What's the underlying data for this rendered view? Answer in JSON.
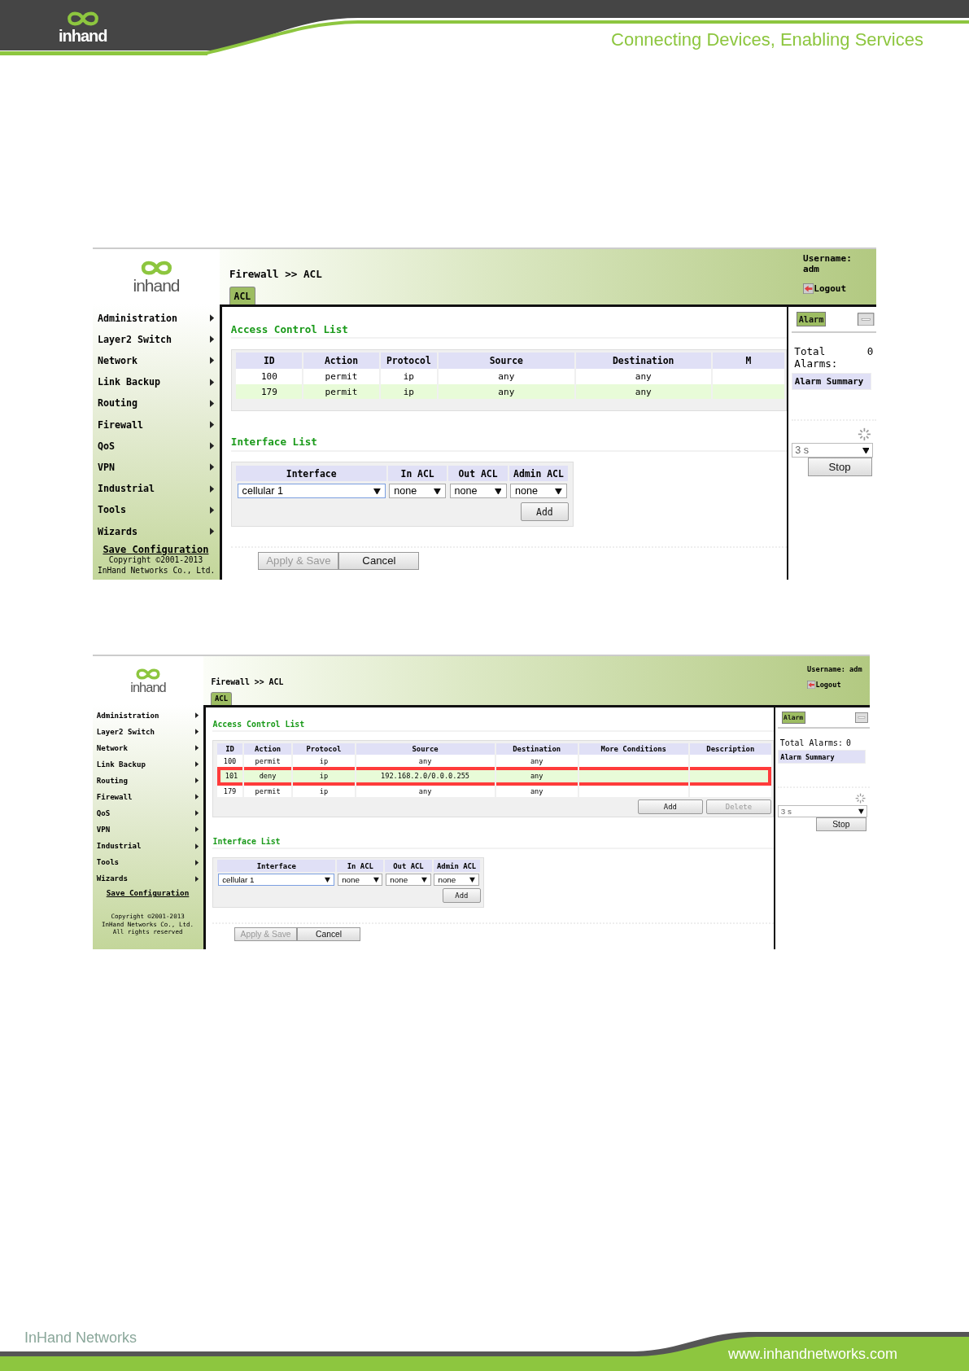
{
  "page_header": {
    "logo_text": "inhand",
    "tagline": "Connecting Devices, Enabling Services"
  },
  "screenshots": [
    {
      "logo_text": "inhand",
      "breadcrumb": "Firewall >> ACL",
      "tabs": [
        {
          "label": "ACL",
          "selected": true
        }
      ],
      "username_lines": [
        "Username:",
        "adm"
      ],
      "logout": "Logout",
      "menu": [
        {
          "label": "Administration"
        },
        {
          "label": "Layer2 Switch"
        },
        {
          "label": "Network"
        },
        {
          "label": "Link Backup"
        },
        {
          "label": "Routing"
        },
        {
          "label": "Firewall"
        },
        {
          "label": "QoS"
        },
        {
          "label": "VPN"
        },
        {
          "label": "Industrial"
        },
        {
          "label": "Tools"
        },
        {
          "label": "Wizards"
        }
      ],
      "save_link": "Save Configuration",
      "copyright_lines": [
        "Copyright ©2001-2013",
        "InHand Networks Co., Ltd."
      ],
      "acl": {
        "title": "Access Control List",
        "columns": [
          "ID",
          "Action",
          "Protocol",
          "Source",
          "Destination",
          "M"
        ],
        "rows": [
          {
            "cells": [
              "100",
              "permit",
              "ip",
              "any",
              "any"
            ],
            "highlighted": false,
            "marked": false
          },
          {
            "cells": [
              "179",
              "permit",
              "ip",
              "any",
              "any"
            ],
            "highlighted": true,
            "marked": false
          }
        ]
      },
      "interfaces": {
        "title": "Interface List",
        "columns": [
          "Interface",
          "In ACL",
          "Out ACL",
          "Admin ACL"
        ],
        "values": [
          "cellular 1",
          "none",
          "none",
          "none"
        ],
        "add_button": "Add"
      },
      "actions": [
        {
          "label": "Apply & Save",
          "disabled": true
        },
        {
          "label": "Cancel",
          "disabled": false
        }
      ],
      "alarm": {
        "tab": "Alarm",
        "total_label": "Total Alarms:",
        "total_value": "0",
        "summary": "Alarm Summary",
        "refresh": "3 s",
        "stop": "Stop"
      }
    },
    {
      "logo_text": "inhand",
      "breadcrumb": "Firewall >> ACL",
      "tabs": [
        {
          "label": "ACL",
          "selected": true
        }
      ],
      "username_lines": [
        "Username: adm"
      ],
      "logout": "Logout",
      "menu": [
        {
          "label": "Administration"
        },
        {
          "label": "Layer2 Switch"
        },
        {
          "label": "Network"
        },
        {
          "label": "Link Backup"
        },
        {
          "label": "Routing"
        },
        {
          "label": "Firewall"
        },
        {
          "label": "QoS"
        },
        {
          "label": "VPN"
        },
        {
          "label": "Industrial"
        },
        {
          "label": "Tools"
        },
        {
          "label": "Wizards"
        }
      ],
      "save_link": "Save Configuration",
      "copyright_lines": [
        "Copyright ©2001-2013",
        "InHand Networks Co., Ltd.",
        "All rights reserved"
      ],
      "acl": {
        "title": "Access Control List",
        "columns": [
          "ID",
          "Action",
          "Protocol",
          "Source",
          "Destination",
          "More Conditions",
          "Description"
        ],
        "rows": [
          {
            "cells": [
              "100",
              "permit",
              "ip",
              "any",
              "any"
            ],
            "highlighted": false,
            "marked": false
          },
          {
            "cells": [
              "101",
              "deny",
              "ip",
              "192.168.2.0/0.0.0.255",
              "any"
            ],
            "highlighted": true,
            "marked": true
          },
          {
            "cells": [
              "179",
              "permit",
              "ip",
              "any",
              "any"
            ],
            "highlighted": false,
            "marked": false
          }
        ],
        "buttons": [
          {
            "label": "Add",
            "disabled": false
          },
          {
            "label": "Delete",
            "disabled": true
          }
        ]
      },
      "interfaces": {
        "title": "Interface List",
        "columns": [
          "Interface",
          "In ACL",
          "Out ACL",
          "Admin ACL"
        ],
        "values": [
          "cellular 1",
          "none",
          "none",
          "none"
        ],
        "add_button": "Add"
      },
      "actions": [
        {
          "label": "Apply & Save",
          "disabled": true
        },
        {
          "label": "Cancel",
          "disabled": false
        }
      ],
      "alarm": {
        "tab": "Alarm",
        "total_label": "Total Alarms:",
        "total_value": "0",
        "summary": "Alarm Summary",
        "refresh": "3 s",
        "stop": "Stop"
      }
    }
  ],
  "page_footer": {
    "company": "InHand Networks",
    "website": "www.inhandnetworks.com"
  }
}
